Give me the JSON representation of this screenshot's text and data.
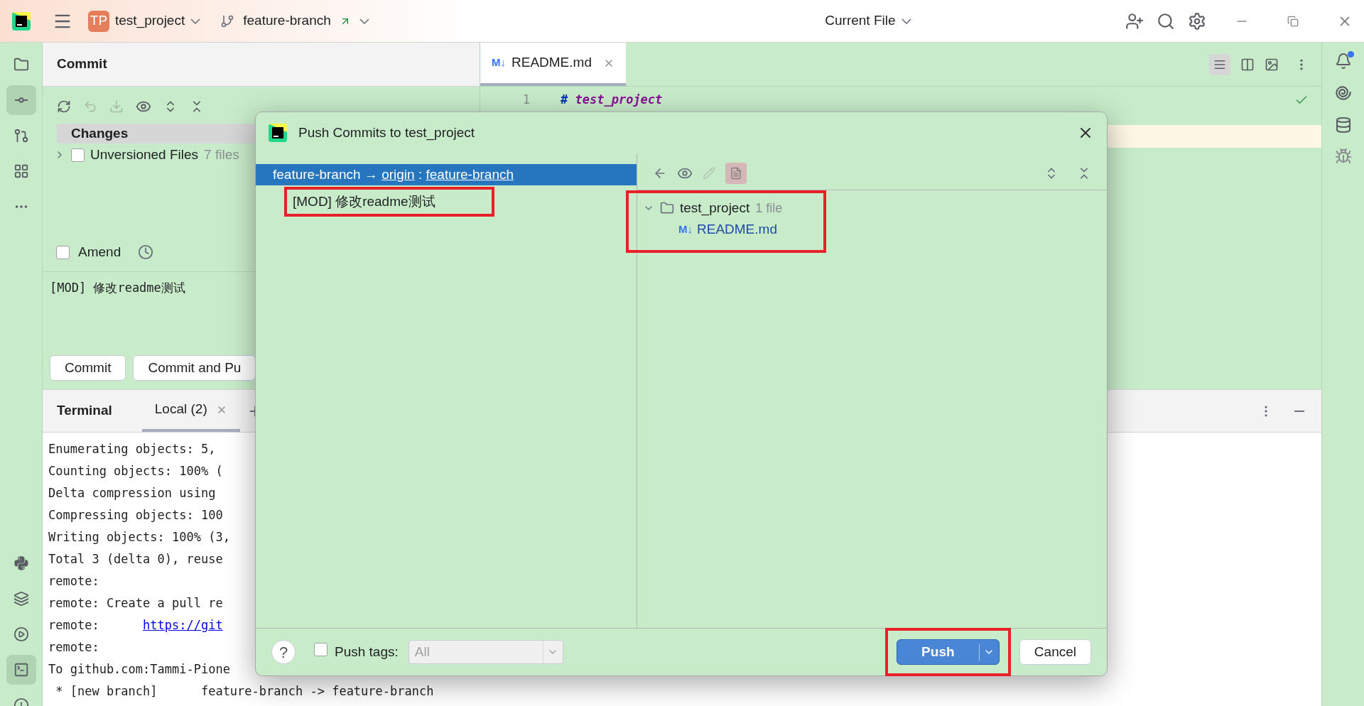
{
  "title_bar": {
    "project_badge": "TP",
    "project": "test_project",
    "branch": "feature-branch",
    "run_config": "Current File"
  },
  "left_toolbar": {
    "top": [
      {
        "selected": false
      },
      {
        "selected": true
      },
      {
        "selected": false
      },
      {
        "selected": false
      },
      {
        "selected": false
      }
    ],
    "bottom": [
      {
        "selected": false
      },
      {
        "selected": false
      },
      {
        "selected": false
      },
      {
        "selected": true
      },
      {
        "selected": false
      }
    ]
  },
  "commit_panel": {
    "title": "Commit",
    "changes_header": "Changes",
    "groups": [
      {
        "label": "Unversioned Files",
        "count": "7 files",
        "expanded": false,
        "checked": false
      }
    ],
    "amend": {
      "label": "Amend",
      "checked": false
    },
    "message": "[MOD] 修改readme测试",
    "buttons": [
      "Commit",
      "Commit and Pu"
    ]
  },
  "editor": {
    "tabs": [
      {
        "badge": "M↓",
        "label": "README.md",
        "selected": true
      }
    ],
    "lines": [
      {
        "number": "1",
        "marker": "#",
        "text": "test_project"
      }
    ]
  },
  "terminal": {
    "title": "Terminal",
    "tabs": [
      {
        "label": "Local (2)",
        "selected": true
      }
    ],
    "lines": [
      {
        "text": "Enumerating objects: 5,"
      },
      {
        "text": "Counting objects: 100% ("
      },
      {
        "text": "Delta compression using"
      },
      {
        "text": "Compressing objects: 100"
      },
      {
        "text": "Writing objects: 100% (3,"
      },
      {
        "text": "Total 3 (delta 0), reuse"
      },
      {
        "text": "remote:"
      },
      {
        "text": "remote: Create a pull re"
      },
      {
        "text": "remote:      ",
        "link": "https://git"
      },
      {
        "text": "remote:"
      },
      {
        "text": "To github.com:Tammi-Pione"
      },
      {
        "text": " * [new branch]      feature-branch -> feature-branch"
      }
    ]
  },
  "dialog": {
    "title": "Push Commits to test_project",
    "repos": [
      {
        "branch": "feature-branch",
        "arrow": "→",
        "remote": "origin",
        "separator": ":",
        "target": "feature-branch",
        "selected": true,
        "commits": [
          {
            "label": "[MOD] 修改readme测试",
            "highlighted": true
          }
        ]
      }
    ],
    "files": {
      "highlighted": true,
      "tree": [
        {
          "label": "test_project",
          "count": "1 file",
          "expanded": true,
          "children": [
            {
              "badge": "M↓",
              "label": "README.md"
            }
          ]
        }
      ]
    },
    "help": "?",
    "push_tags": {
      "label": "Push tags:",
      "checked": false,
      "value": "All",
      "disabled": true
    },
    "push": {
      "label": "Push",
      "highlighted": true
    },
    "cancel": "Cancel"
  }
}
